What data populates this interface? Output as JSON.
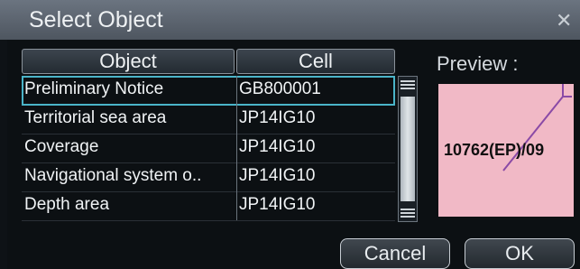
{
  "window": {
    "title": "Select Object"
  },
  "table": {
    "columns": [
      "Object",
      "Cell"
    ],
    "rows": [
      {
        "object": "Preliminary Notice",
        "cell": "GB800001"
      },
      {
        "object": "Territorial sea area",
        "cell": "JP14IG10"
      },
      {
        "object": "Coverage",
        "cell": "JP14IG10"
      },
      {
        "object": "Navigational system o..",
        "cell": "JP14IG10"
      },
      {
        "object": "Depth area",
        "cell": "JP14IG10"
      }
    ]
  },
  "preview": {
    "label": "Preview :",
    "text": "10762(EP)/09"
  },
  "buttons": {
    "cancel": "Cancel",
    "ok": "OK"
  },
  "colors": {
    "selection": "#4ab4c8",
    "preview_bg": "#f1b9c6",
    "preview_line": "#8a4aa6"
  }
}
